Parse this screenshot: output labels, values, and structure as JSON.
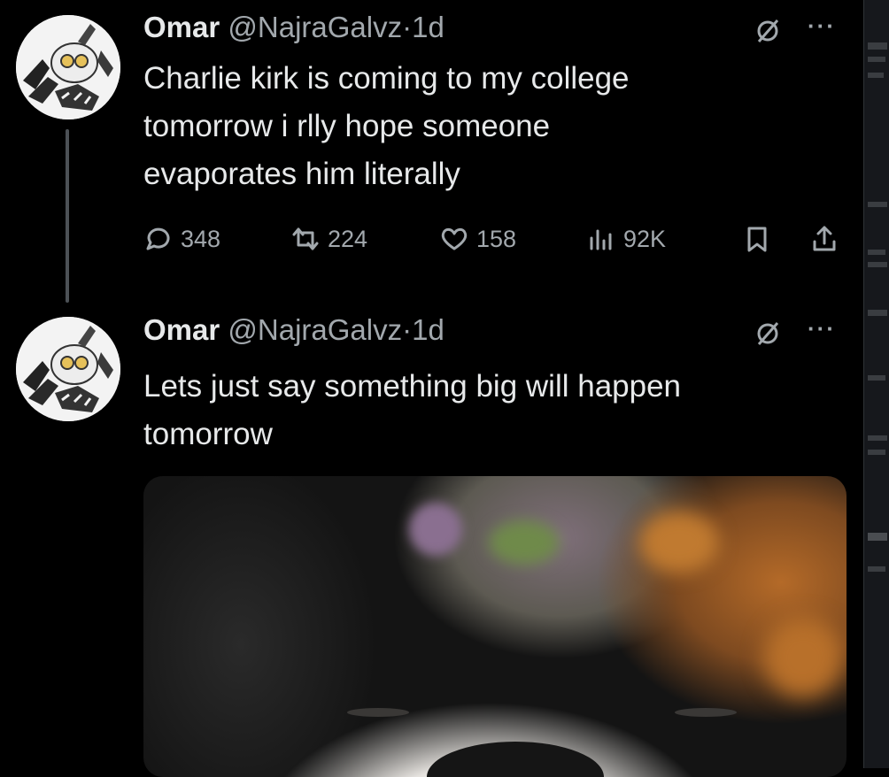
{
  "tweets": [
    {
      "name": "Omar",
      "handle": "@NajraGalvz",
      "separator": "·",
      "time": "1d",
      "text_lines": [
        "Charlie kirk is coming to my college",
        "tomorrow i rlly hope someone",
        "evaporates him literally"
      ],
      "stats": {
        "replies": "348",
        "reposts": "224",
        "likes": "158",
        "views": "92K"
      }
    },
    {
      "name": "Omar",
      "handle": "@NajraGalvz",
      "separator": "·",
      "time": "1d",
      "text_lines": [
        "Lets just say something big will happen",
        "tomorrow"
      ]
    }
  ],
  "icons": {
    "grok": "grok-icon",
    "more": "more-icon",
    "reply": "reply-icon",
    "repost": "repost-icon",
    "like": "like-icon",
    "views": "views-icon",
    "bookmark": "bookmark-icon",
    "share": "share-icon"
  },
  "colors": {
    "background": "#000000",
    "text": "#e7e9ea",
    "secondary_text": "#a2a8ad",
    "thread_line": "#4c5156"
  }
}
